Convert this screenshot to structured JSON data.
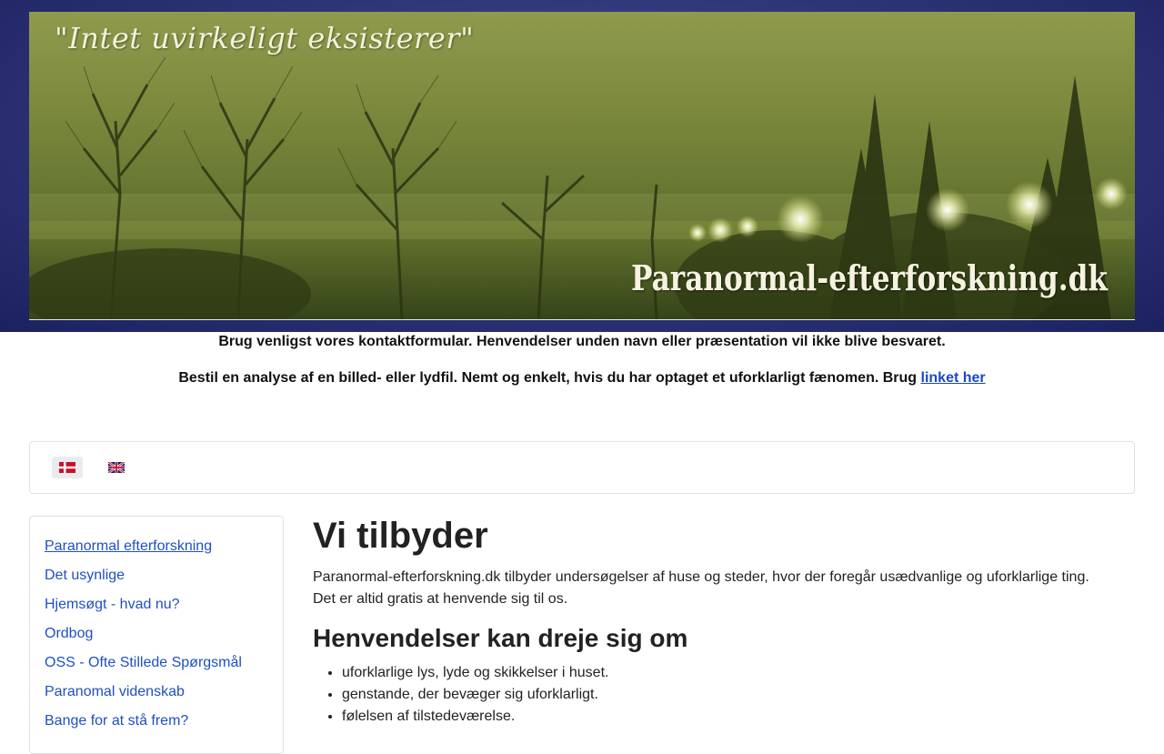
{
  "banner": {
    "quote": "\"Intet uvirkeligt eksisterer\"",
    "site_title": "Paranormal-efterforskning.dk"
  },
  "notices": {
    "contact": "Brug venligst vores kontaktformular. Henvendelser unden navn eller præsentation vil ikke blive besvaret.",
    "analysis_text": "Bestil en analyse af en billed- eller lydfil. Nemt og enkelt, hvis du har optaget et uforklarligt fænomen. Brug ",
    "analysis_link": "linket her"
  },
  "languages": [
    {
      "code": "da",
      "icon": "danish-flag-icon",
      "selected": true
    },
    {
      "code": "en",
      "icon": "uk-flag-icon",
      "selected": false
    }
  ],
  "sidebar": {
    "items": [
      {
        "label": "Paranormal efterforskning",
        "active": true
      },
      {
        "label": "Det usynlige"
      },
      {
        "label": "Hjemsøgt - hvad nu?"
      },
      {
        "label": "Ordbog"
      },
      {
        "label": "OSS - Ofte Stillede Spørgsmål"
      },
      {
        "label": "Paranomal videnskab"
      },
      {
        "label": "Bange for at stå frem?"
      }
    ]
  },
  "main": {
    "title": "Vi tilbyder",
    "intro_line1": "Paranormal-efterforskning.dk tilbyder undersøgelser af huse og steder, hvor  der foregår usædvanlige og uforklarlige ting.",
    "intro_line2": "Det er altid gratis at henvende sig til os.",
    "subtitle": "Henvendelser kan dreje sig om",
    "topics": [
      "uforklarlige lys, lyde og skikkelser i huset.",
      "genstande, der bevæger sig uforklarligt.",
      "følelsen af tilstedeværelse."
    ]
  },
  "colors": {
    "header_band": "#2e3477",
    "link": "#1f4fc4",
    "banner_tint": "#7d8a3e"
  }
}
